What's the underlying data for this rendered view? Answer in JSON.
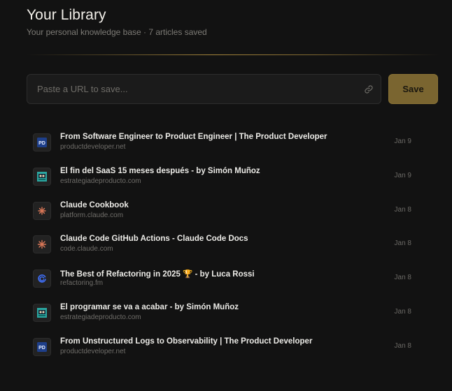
{
  "header": {
    "title": "Your Library",
    "subtitle": "Your personal knowledge base · 7 articles saved"
  },
  "url_form": {
    "placeholder": "Paste a URL to save...",
    "value": "",
    "save_label": "Save"
  },
  "colors": {
    "background": "#121212",
    "accent": "#7a6530",
    "divider": "#d4aa48"
  },
  "articles": [
    {
      "title": "From Software Engineer to Product Engineer | The Product Developer",
      "domain": "productdeveloper.net",
      "date": "Jan 9",
      "icon": "pd-favicon-icon"
    },
    {
      "title": "El fin del SaaS 15 meses después - by Simón Muñoz",
      "domain": "estrategiadeproducto.com",
      "date": "Jan 9",
      "icon": "ep-favicon-icon"
    },
    {
      "title": "Claude Cookbook",
      "domain": "platform.claude.com",
      "date": "Jan 8",
      "icon": "claude-favicon-icon"
    },
    {
      "title": "Claude Code GitHub Actions - Claude Code Docs",
      "domain": "code.claude.com",
      "date": "Jan 8",
      "icon": "claude-favicon-icon"
    },
    {
      "title": "The Best of Refactoring in 2025 🏆 - by Luca Rossi",
      "domain": "refactoring.fm",
      "date": "Jan 8",
      "icon": "refactoring-favicon-icon"
    },
    {
      "title": "El programar se va a acabar - by Simón Muñoz",
      "domain": "estrategiadeproducto.com",
      "date": "Jan 8",
      "icon": "ep-favicon-icon"
    },
    {
      "title": "From Unstructured Logs to Observability | The Product Developer",
      "domain": "productdeveloper.net",
      "date": "Jan 8",
      "icon": "pd-favicon-icon"
    }
  ]
}
